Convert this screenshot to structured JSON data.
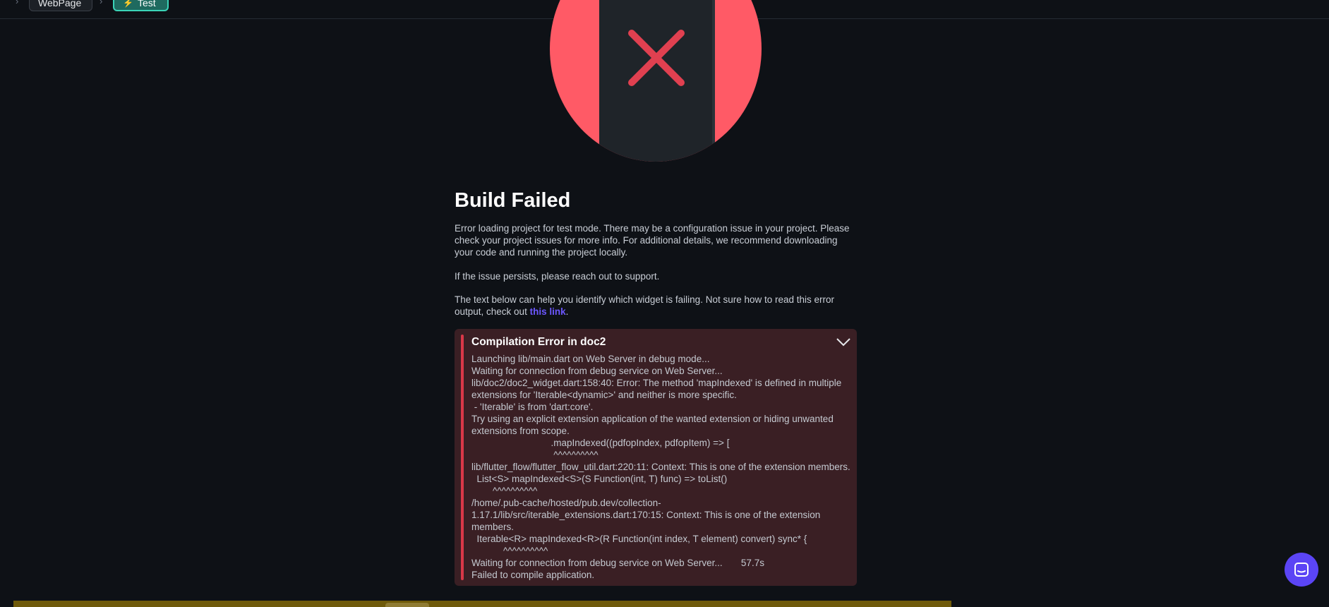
{
  "breadcrumb": {
    "items": [
      {
        "label": "WebPage"
      },
      {
        "label": "Test",
        "icon": "bolt-icon"
      }
    ]
  },
  "hero": {
    "icon": "build-failed-illustration",
    "accent_color": "#ff5a66"
  },
  "title": "Build Failed",
  "paragraphs": {
    "p1": "Error loading project for test mode. There may be a configuration issue in your project. Please check your project issues for more info. For additional details, we recommend downloading your code and running the project locally.",
    "p2": "If the issue persists, please reach out to support.",
    "p3_before": "The text below can help you identify which widget is failing. Not sure how to read this error output, check out ",
    "p3_link": "this link",
    "p3_after": "."
  },
  "error": {
    "title": "Compilation Error in doc2",
    "log": "Launching lib/main.dart on Web Server in debug mode...\nWaiting for connection from debug service on Web Server...\nlib/doc2/doc2_widget.dart:158:40: Error: The method 'mapIndexed' is defined in multiple extensions for 'Iterable<dynamic>' and neither is more specific.\n - 'Iterable' is from 'dart:core'.\nTry using an explicit extension application of the wanted extension or hiding unwanted extensions from scope.\n                              .mapIndexed((pdfopIndex, pdfopItem) => [\n                               ^^^^^^^^^^\nlib/flutter_flow/flutter_flow_util.dart:220:11: Context: This is one of the extension members.\n  List<S> mapIndexed<S>(S Function(int, T) func) => toList()\n        ^^^^^^^^^^\n/home/.pub-cache/hosted/pub.dev/collection-1.17.1/lib/src/iterable_extensions.dart:170:15: Context: This is one of the extension members.\n  Iterable<R> mapIndexed<R>(R Function(int index, T element) convert) sync* {\n            ^^^^^^^^^^\nWaiting for connection from debug service on Web Server...       57.7s\nFailed to compile application.",
    "accent_color": "#d93848"
  },
  "chat": {
    "icon": "chat-icon",
    "color": "#5b45f5"
  }
}
